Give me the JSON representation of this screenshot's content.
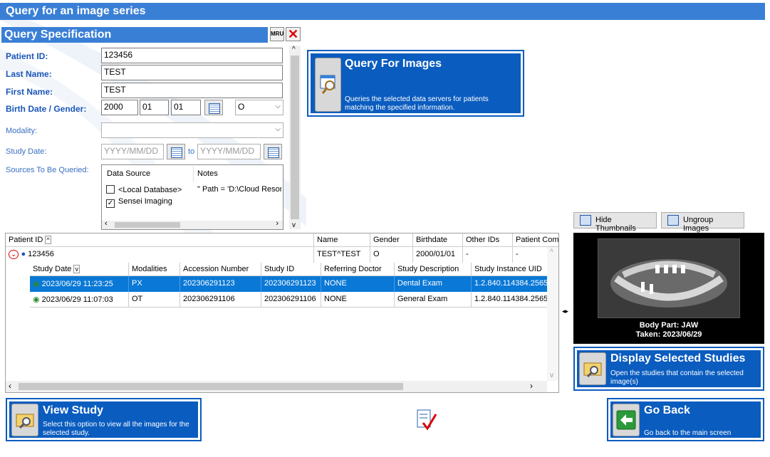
{
  "window": {
    "title": "Query for an image series"
  },
  "query_spec": {
    "header": "Query Specification",
    "mru_label": "MRU",
    "patient_id": {
      "label": "Patient ID:",
      "value": "123456"
    },
    "last_name": {
      "label": "Last Name:",
      "value": "TEST"
    },
    "first_name": {
      "label": "First Name:",
      "value": "TEST"
    },
    "birth_date": {
      "label": "Birth Date / Gender:",
      "year": "2000",
      "month": "01",
      "day": "01",
      "gender": "O"
    },
    "modality": {
      "label": "Modality:",
      "value": ""
    },
    "study_date": {
      "label": "Study Date:",
      "from_placeholder": "YYYY/MM/DD",
      "to_label": "to",
      "to_placeholder": "YYYY/MM/DD"
    },
    "sources": {
      "label": "Sources To Be Queried:",
      "col_source": "Data Source",
      "col_notes": "Notes",
      "items": [
        {
          "name": "<Local Database>",
          "checked": false,
          "notes": "\" Path = 'D:\\Cloud Resor"
        },
        {
          "name": "Sensei Imaging",
          "checked": true,
          "notes": ""
        }
      ]
    }
  },
  "query_button": {
    "title": "Query For Images",
    "desc": "Queries the selected data servers for patients matching the specified information."
  },
  "thumbs": {
    "hide_label": "Hide Thumbnails",
    "ungroup_label": "Ungroup Images",
    "body_part": "Body Part: JAW",
    "taken": "Taken: 2023/06/29"
  },
  "patient_grid": {
    "headers": [
      "Patient ID",
      "Name",
      "Gender",
      "Birthdate",
      "Other IDs",
      "Patient Comr"
    ],
    "patient": {
      "id": "123456",
      "name": "TEST^TEST",
      "gender": "O",
      "birthdate": "2000/01/01",
      "other_ids": "-",
      "comments": "-"
    },
    "study_headers": [
      "Study Date",
      "Modalities",
      "Accession Number",
      "Study ID",
      "Referring Doctor",
      "Study Description",
      "Study Instance UID"
    ],
    "studies": [
      {
        "date": "2023/06/29  11:23:25",
        "modalities": "PX",
        "accession": "202306291123",
        "study_id": "202306291123",
        "doctor": "NONE",
        "description": "Dental Exam",
        "uid": "1.2.840.114384.2565"
      },
      {
        "date": "2023/06/29  11:07:03",
        "modalities": "OT",
        "accession": "202306291106",
        "study_id": "202306291106",
        "doctor": "NONE",
        "description": "General Exam",
        "uid": "1.2.840.114384.2565"
      }
    ]
  },
  "display_button": {
    "title": "Display Selected Studies",
    "desc": "Open the studies that contain the selected image(s)"
  },
  "view_button": {
    "title": "View Study",
    "desc": "Select this option to view all the images for the selected study."
  },
  "back_button": {
    "title": "Go Back",
    "desc": "Go back to the main screen"
  },
  "colors": {
    "accent": "#0a5cbf",
    "title_bar": "#3a7fd6",
    "selection": "#0a78d6"
  }
}
